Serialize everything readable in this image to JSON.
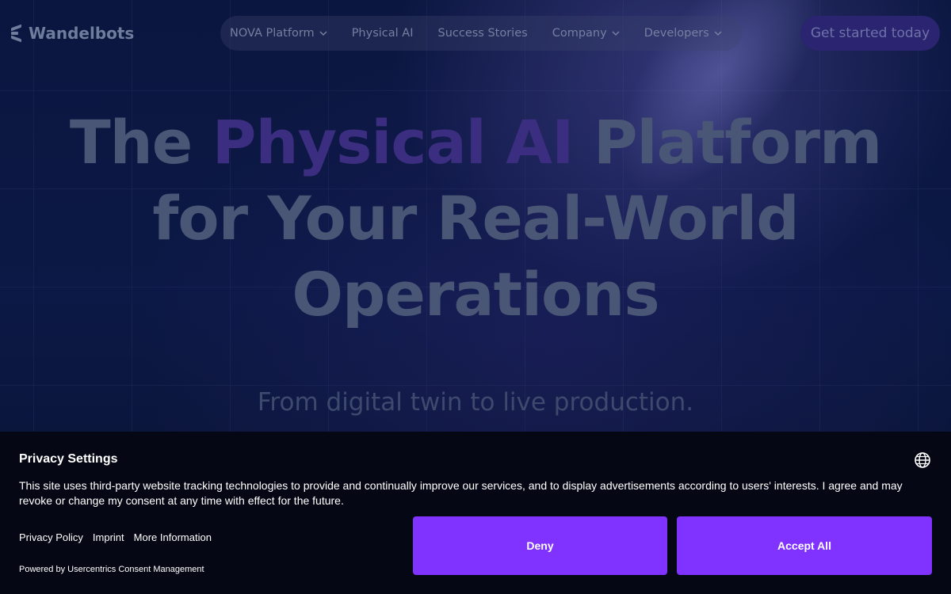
{
  "header": {
    "logo_text": "Wandelbots",
    "nav": [
      {
        "label": "NOVA Platform",
        "has_dropdown": true
      },
      {
        "label": "Physical AI",
        "has_dropdown": false
      },
      {
        "label": "Success Stories",
        "has_dropdown": false
      },
      {
        "label": "Company",
        "has_dropdown": true
      },
      {
        "label": "Developers",
        "has_dropdown": true
      }
    ],
    "cta_label": "Get started today"
  },
  "hero": {
    "line1_pre": "The ",
    "line1_accent": "Physical AI",
    "line1_post": " Platform",
    "line2": "for Your Real-World",
    "line3": "Operations",
    "subtitle": "From digital twin to live production."
  },
  "consent": {
    "title": "Privacy Settings",
    "body": "This site uses third-party website tracking technologies to provide and continually improve our services, and to display advertisements according to users' interests. I agree and may revoke or change my consent at any time with effect for the future.",
    "links": [
      "Privacy Policy",
      "Imprint",
      "More Information"
    ],
    "powered_by": "Powered by Usercentrics Consent Management",
    "deny_label": "Deny",
    "accept_label": "Accept All",
    "button_color": "#8033ff",
    "language_icon": "globe-icon"
  }
}
